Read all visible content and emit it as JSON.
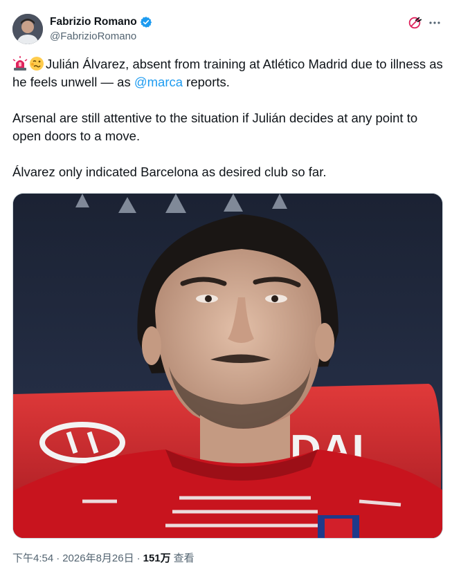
{
  "author": {
    "display_name": "Fabrizio Romano",
    "handle": "@FabrizioRomano",
    "verified": true,
    "verified_color": "#1d9bf0"
  },
  "tweet": {
    "line1_before_mention": "Julián Álvarez, absent from training at Atlético Madrid due to illness as he feels unwell — as ",
    "mention": "@marca",
    "line1_after_mention": " reports.",
    "paragraph2": "Arsenal are still attentive to the situation if Julián decides at any point to open doors to a move.",
    "paragraph3": "Álvarez only indicated Barcelona as desired club so far.",
    "emojis": [
      "siren-emoji",
      "woozy-face-emoji"
    ]
  },
  "media": {
    "sponsor_text": "DAI"
  },
  "footer": {
    "time": "下午4:54",
    "separator": "·",
    "date": "2026年8月26日",
    "views_count": "151万",
    "views_label": "查看"
  },
  "colors": {
    "text": "#0f1419",
    "secondary": "#536471",
    "link": "#1d9bf0",
    "shirt_red": "#c8141e"
  }
}
